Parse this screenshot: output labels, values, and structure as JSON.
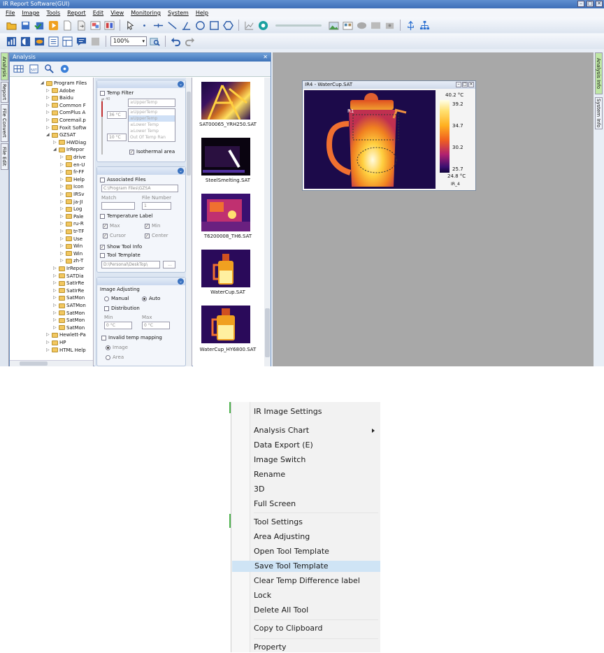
{
  "app": {
    "title": "IR Report Software(GUI)",
    "menus": [
      "File",
      "Image",
      "Tools",
      "Report",
      "Edit",
      "View",
      "Monitoring",
      "System",
      "Help"
    ],
    "zoom": "100%",
    "left_tabs": [
      "Analysis",
      "Report",
      "File Convert",
      "File Edit"
    ],
    "right_tabs": [
      "Analysis Info",
      "System Info"
    ]
  },
  "analysis": {
    "title": "Analysis",
    "close": "✕",
    "tree": [
      {
        "label": "Program Files",
        "level": 0,
        "open": true
      },
      {
        "label": "Adobe",
        "level": 1
      },
      {
        "label": "Baidu",
        "level": 1
      },
      {
        "label": "Common F",
        "level": 1
      },
      {
        "label": "ComPlus A",
        "level": 1
      },
      {
        "label": "Coremail.p",
        "level": 1
      },
      {
        "label": "Foxit Softw",
        "level": 1
      },
      {
        "label": "GZSAT",
        "level": 1,
        "open": true
      },
      {
        "label": "HWDiag",
        "level": 2
      },
      {
        "label": "IrRepor",
        "level": 2,
        "open": true
      },
      {
        "label": "drive",
        "level": 3
      },
      {
        "label": "en-U",
        "level": 3
      },
      {
        "label": "fr-FF",
        "level": 3
      },
      {
        "label": "Help",
        "level": 3
      },
      {
        "label": "Icon",
        "level": 3
      },
      {
        "label": "IRSv",
        "level": 3
      },
      {
        "label": "ja-JI",
        "level": 3
      },
      {
        "label": "Log",
        "level": 3
      },
      {
        "label": "Pale",
        "level": 3
      },
      {
        "label": "ru-R",
        "level": 3
      },
      {
        "label": "tr-TF",
        "level": 3
      },
      {
        "label": "Use",
        "level": 3
      },
      {
        "label": "Win",
        "level": 3
      },
      {
        "label": "Win",
        "level": 3
      },
      {
        "label": "zh-T",
        "level": 3
      },
      {
        "label": "IrRepor",
        "level": 2
      },
      {
        "label": "SATDia",
        "level": 2
      },
      {
        "label": "SatIrRe",
        "level": 2
      },
      {
        "label": "SatIrRe",
        "level": 2
      },
      {
        "label": "SatMon",
        "level": 2
      },
      {
        "label": "SATMon",
        "level": 2
      },
      {
        "label": "SatMon",
        "level": 2
      },
      {
        "label": "SatMon",
        "level": 2
      },
      {
        "label": "SatMon",
        "level": 2
      },
      {
        "label": "Hewlett-Pa",
        "level": 1
      },
      {
        "label": "HP",
        "level": 1
      },
      {
        "label": "HTML Help",
        "level": 1
      }
    ],
    "settings": {
      "temp_filter": "Temp Filter",
      "scale_top": "▸ 40",
      "temp_high": "36 °C",
      "temp_low": "10 °C",
      "filter_options": [
        "≥UpperTemp",
        "≤UpperTemp",
        "≥Upper Temp",
        "≤Lower Temp",
        "≥Lower Temp",
        "Out Of Temp Ran"
      ],
      "isothermal": "Isothermal area",
      "associated_files": "Associated Files",
      "assoc_path": "C:\\Program Files\\GZSA",
      "match_label": "Match",
      "file_number_label": "File Number",
      "file_number": "1",
      "temperature_label": "Temperature Label",
      "max": "Max",
      "min": "Min",
      "cursor": "Cursor",
      "center": "Center",
      "show_tool_info": "Show Tool Info",
      "tool_template": "Tool Template",
      "template_path": "D:\\Personal\\DeskTop\\",
      "browse": "...",
      "image_adjusting": "Image Adjusting",
      "manual": "Manual",
      "auto": "Auto",
      "distribution": "Distribution",
      "min_label": "Min",
      "max_label": "Max",
      "min_val": "0 °C",
      "max_val": "0 °C",
      "invalid_temp": "Invalid temp mapping",
      "image_opt": "Image",
      "area_opt": "Area"
    },
    "thumbnails": [
      "SAT00065_YRH250.SAT",
      "SteelSmelting.SAT",
      "T6200008_TH6.SAT",
      "WaterCup.SAT",
      "WaterCup_HY6800.SAT"
    ]
  },
  "image_window": {
    "title": "IR4 - WaterCup.SAT",
    "roi_label": "R1",
    "scale_max": "40.2 °C",
    "scale_ticks": [
      "39.2",
      "34.7",
      "30.2",
      "25.7"
    ],
    "scale_min": "24.8 °C",
    "palette": "IR_4"
  },
  "context_menu": {
    "items": [
      {
        "label": "IR Image Settings",
        "submenu": false
      },
      {
        "label": "Analysis Chart",
        "submenu": true
      },
      {
        "label": "Data Export (E)",
        "submenu": false
      },
      {
        "label": "Image Switch",
        "submenu": false
      },
      {
        "label": "Rename",
        "submenu": false
      },
      {
        "label": "3D",
        "submenu": false
      },
      {
        "label": "Full Screen",
        "submenu": false
      },
      {
        "label": "Tool Settings",
        "submenu": false
      },
      {
        "label": "Area Adjusting",
        "submenu": false
      },
      {
        "label": "Open Tool  Template",
        "submenu": false
      },
      {
        "label": "Save Tool  Template",
        "submenu": false,
        "highlighted": true
      },
      {
        "label": "Clear Temp Difference label",
        "submenu": false
      },
      {
        "label": "Lock",
        "submenu": false
      },
      {
        "label": "Delete All Tool",
        "submenu": false
      },
      {
        "label": "Copy to Clipboard",
        "submenu": false
      },
      {
        "label": "Property",
        "submenu": false
      }
    ]
  },
  "colors": {
    "highlight": "#cfe4f5",
    "workspace": "#a8a8a8",
    "panel_header": "#3e72b8",
    "active_tab": "#bfe7a5"
  }
}
